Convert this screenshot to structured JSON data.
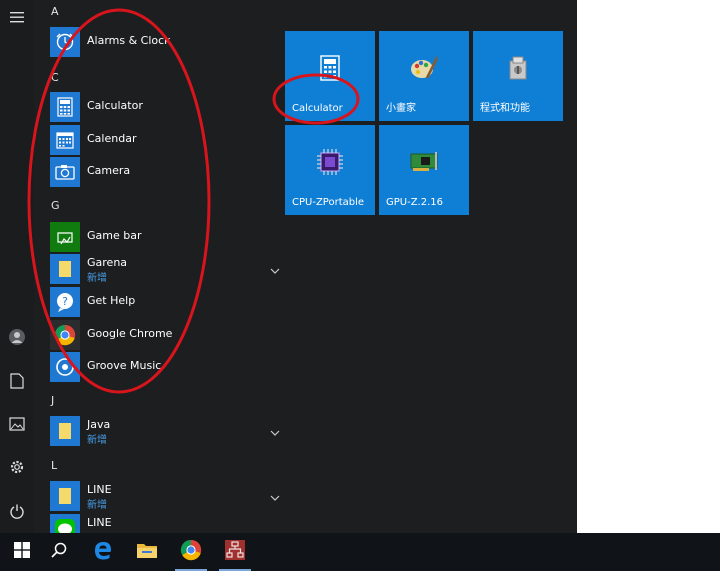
{
  "apps": {
    "sections": [
      {
        "letter": "A",
        "items": [
          {
            "name": "Alarms & Clock",
            "icon": "clock-icon"
          }
        ]
      },
      {
        "letter": "C",
        "items": [
          {
            "name": "Calculator",
            "icon": "calculator-icon"
          },
          {
            "name": "Calendar",
            "icon": "calendar-icon"
          },
          {
            "name": "Camera",
            "icon": "camera-icon"
          }
        ]
      },
      {
        "letter": "G",
        "items": [
          {
            "name": "Game bar",
            "icon": "game-bar-icon"
          },
          {
            "name": "Garena",
            "sub": "新增",
            "icon": "folder-icon"
          },
          {
            "name": "Get Help",
            "icon": "help-icon"
          },
          {
            "name": "Google Chrome",
            "icon": "chrome-icon"
          },
          {
            "name": "Groove Music",
            "icon": "music-icon"
          }
        ]
      },
      {
        "letter": "J",
        "items": [
          {
            "name": "Java",
            "sub": "新增",
            "icon": "folder-icon"
          }
        ]
      },
      {
        "letter": "L",
        "items": [
          {
            "name": "LINE",
            "sub": "新增",
            "icon": "folder-icon"
          },
          {
            "name": "LINE",
            "icon": "line-icon"
          }
        ]
      }
    ]
  },
  "tiles": [
    {
      "label": "Calculator",
      "icon": "calculator-icon"
    },
    {
      "label": "小畫家",
      "icon": "paint-icon"
    },
    {
      "label": "程式和功能",
      "icon": "programs-icon"
    },
    {
      "label": "CPU-ZPortable",
      "icon": "cpu-icon"
    },
    {
      "label": "GPU-Z.2.16",
      "icon": "gpu-icon"
    }
  ],
  "taskbar": [
    {
      "name": "start-button",
      "icon": "windows-icon"
    },
    {
      "name": "search-button",
      "icon": "search-icon"
    },
    {
      "name": "edge-button",
      "icon": "edge-icon"
    },
    {
      "name": "file-explorer-button",
      "icon": "folder-icon"
    },
    {
      "name": "chrome-button",
      "icon": "chrome-icon"
    },
    {
      "name": "network-app-button",
      "icon": "network-icon"
    }
  ],
  "colors": {
    "accent": "#0f7fd6",
    "annotation": "#d8141c",
    "start_bg": "#1c1e20",
    "taskbar_bg": "#101418"
  }
}
